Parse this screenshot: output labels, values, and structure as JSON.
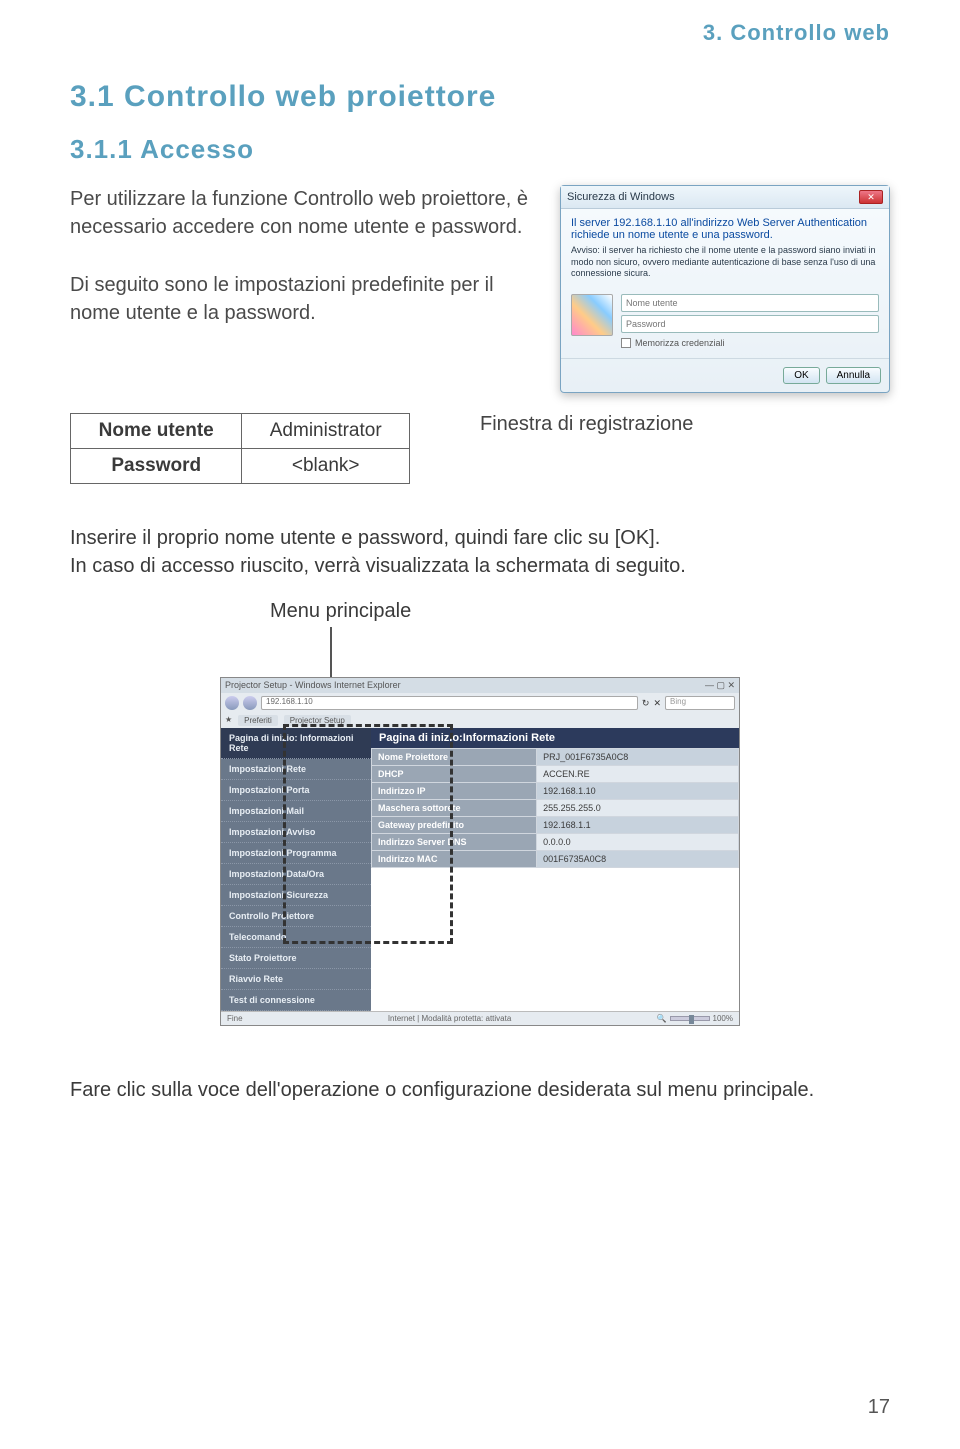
{
  "header": {
    "tag": "3. Controllo web"
  },
  "section": {
    "title": "3.1 Controllo web proiettore",
    "sub": "3.1.1 Accesso",
    "p1": "Per utilizzare la funzione Controllo web proiettore, è necessario accedere con nome utente e password.",
    "p2": "Di seguito sono le impostazioni predefinite per il nome utente e la password."
  },
  "dialog": {
    "title": "Sicurezza di Windows",
    "line1": "Il server 192.168.1.10 all'indirizzo Web Server Authentication richiede un nome utente e una password.",
    "line2": "Avviso: il server ha richiesto che il nome utente e la password siano inviati in modo non sicuro, ovvero mediante autenticazione di base senza l'uso di una connessione sicura.",
    "user_ph": "Nome utente",
    "pass_ph": "Password",
    "remember": "Memorizza credenziali",
    "ok": "OK",
    "cancel": "Annulla"
  },
  "cred_table": {
    "r1k": "Nome utente",
    "r1v": "Administrator",
    "r2k": "Password",
    "r2v": "<blank>"
  },
  "finestra_caption": "Finestra di registrazione",
  "instr": "Inserire il proprio nome utente e password, quindi fare clic su [OK].\nIn caso di accesso riuscito, verrà visualizzata la schermata di seguito.",
  "menu_label": "Menu principale",
  "browser": {
    "title": "Projector Setup - Windows Internet Explorer",
    "address": "192.168.1.10",
    "search": "Bing",
    "tabs": [
      "Preferiti",
      "Projector Setup"
    ],
    "page_header": "Pagina di inizio:Informazioni Rete",
    "sidebar": [
      "Pagina di inizio: Informazioni Rete",
      "Impostazioni Rete",
      "Impostazioni Porta",
      "Impostazioni Mail",
      "Impostazioni Avviso",
      "Impostazioni Programma",
      "Impostazioni Data/Ora",
      "Impostazioni Sicurezza",
      "Controllo Proiettore",
      "Telecomando",
      "Stato Proiettore",
      "Riavvio Rete",
      "Test di connessione"
    ],
    "rows": [
      {
        "k": "Nome Proiettore",
        "v": "PRJ_001F6735A0C8"
      },
      {
        "k": "DHCP",
        "v": "ACCEN.RE"
      },
      {
        "k": "Indirizzo IP",
        "v": "192.168.1.10"
      },
      {
        "k": "Maschera sottorete",
        "v": "255.255.255.0"
      },
      {
        "k": "Gateway predefinito",
        "v": "192.168.1.1"
      },
      {
        "k": "Indirizzo Server DNS",
        "v": "0.0.0.0"
      },
      {
        "k": "Indirizzo MAC",
        "v": "001F6735A0C8"
      }
    ],
    "status_left": "Fine",
    "status_mid": "Internet | Modalità protetta: attivata",
    "zoom": "100%"
  },
  "closing": "Fare clic sulla voce dell'operazione o configurazione desiderata sul menu principale.",
  "pagenum": "17"
}
